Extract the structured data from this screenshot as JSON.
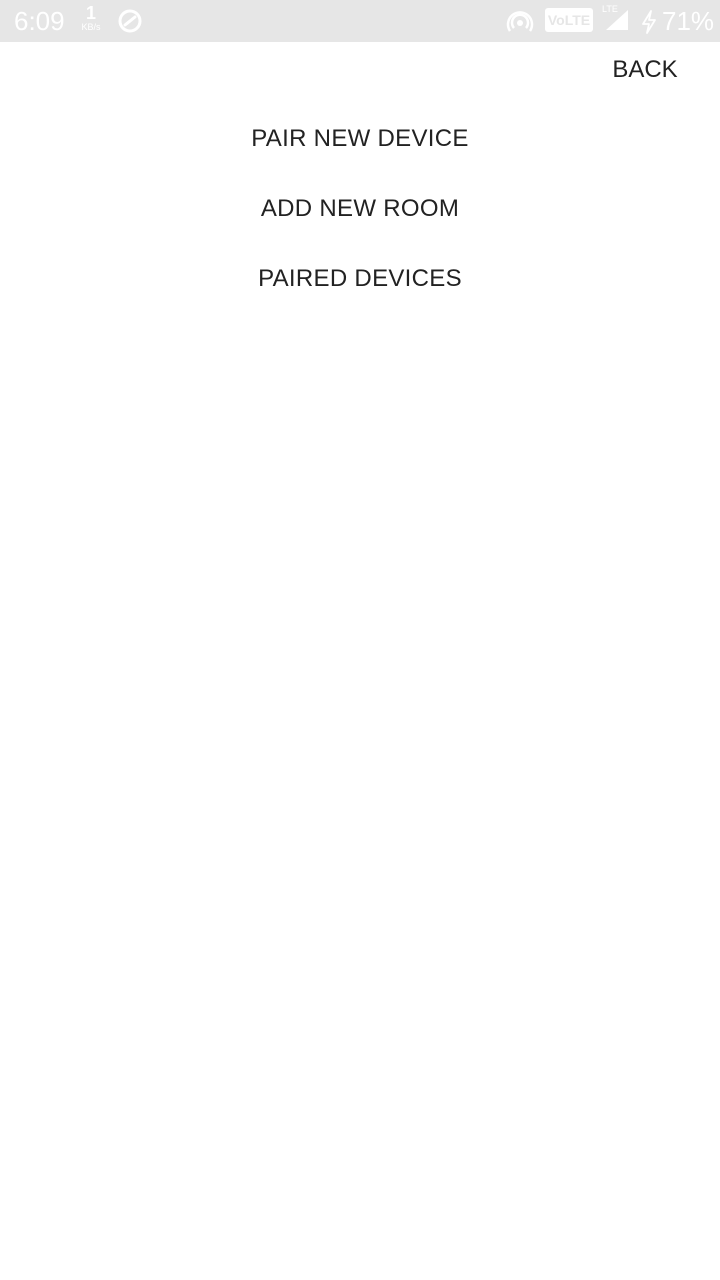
{
  "status_bar": {
    "time": "6:09",
    "net_speed_value": "1",
    "net_speed_unit": "KB/s",
    "volte_label": "VoLTE",
    "lte_label": "LTE",
    "battery_percent": "71%",
    "background_color": "#e6e6e6",
    "icons": [
      "app-notification-icon",
      "hotspot-icon",
      "signal-icon",
      "charging-icon"
    ]
  },
  "header": {
    "back_label": "BACK"
  },
  "menu": {
    "items": [
      {
        "label": "PAIR NEW DEVICE"
      },
      {
        "label": "ADD NEW ROOM"
      },
      {
        "label": "PAIRED DEVICES"
      }
    ]
  },
  "colors": {
    "text": "#222222",
    "background": "#ffffff"
  }
}
